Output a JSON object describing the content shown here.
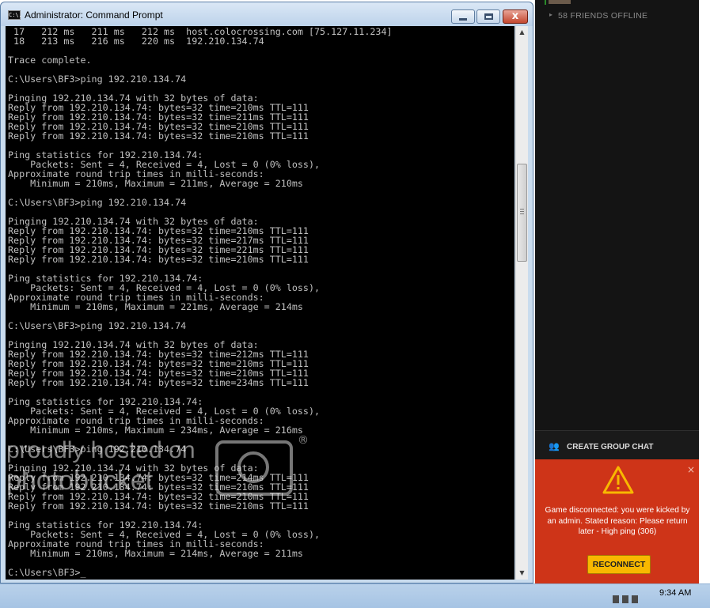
{
  "window": {
    "title": "Administrator: Command Prompt",
    "icon_text": "C:\\.",
    "close_glyph": "x"
  },
  "console": {
    "lines": [
      " 17   212 ms   211 ms   212 ms  host.colocrossing.com [75.127.11.234]",
      " 18   213 ms   216 ms   220 ms  192.210.134.74",
      "",
      "Trace complete.",
      "",
      "C:\\Users\\BF3>ping 192.210.134.74",
      "",
      "Pinging 192.210.134.74 with 32 bytes of data:",
      "Reply from 192.210.134.74: bytes=32 time=210ms TTL=111",
      "Reply from 192.210.134.74: bytes=32 time=211ms TTL=111",
      "Reply from 192.210.134.74: bytes=32 time=210ms TTL=111",
      "Reply from 192.210.134.74: bytes=32 time=210ms TTL=111",
      "",
      "Ping statistics for 192.210.134.74:",
      "    Packets: Sent = 4, Received = 4, Lost = 0 (0% loss),",
      "Approximate round trip times in milli-seconds:",
      "    Minimum = 210ms, Maximum = 211ms, Average = 210ms",
      "",
      "C:\\Users\\BF3>ping 192.210.134.74",
      "",
      "Pinging 192.210.134.74 with 32 bytes of data:",
      "Reply from 192.210.134.74: bytes=32 time=210ms TTL=111",
      "Reply from 192.210.134.74: bytes=32 time=217ms TTL=111",
      "Reply from 192.210.134.74: bytes=32 time=221ms TTL=111",
      "Reply from 192.210.134.74: bytes=32 time=210ms TTL=111",
      "",
      "Ping statistics for 192.210.134.74:",
      "    Packets: Sent = 4, Received = 4, Lost = 0 (0% loss),",
      "Approximate round trip times in milli-seconds:",
      "    Minimum = 210ms, Maximum = 221ms, Average = 214ms",
      "",
      "C:\\Users\\BF3>ping 192.210.134.74",
      "",
      "Pinging 192.210.134.74 with 32 bytes of data:",
      "Reply from 192.210.134.74: bytes=32 time=212ms TTL=111",
      "Reply from 192.210.134.74: bytes=32 time=210ms TTL=111",
      "Reply from 192.210.134.74: bytes=32 time=210ms TTL=111",
      "Reply from 192.210.134.74: bytes=32 time=234ms TTL=111",
      "",
      "Ping statistics for 192.210.134.74:",
      "    Packets: Sent = 4, Received = 4, Lost = 0 (0% loss),",
      "Approximate round trip times in milli-seconds:",
      "    Minimum = 210ms, Maximum = 234ms, Average = 216ms",
      "",
      "C:\\Users\\BF3>ping 192.210.134.74",
      "",
      "Pinging 192.210.134.74 with 32 bytes of data:",
      "Reply from 192.210.134.74: bytes=32 time=214ms TTL=111",
      "Reply from 192.210.134.74: bytes=32 time=210ms TTL=111",
      "Reply from 192.210.134.74: bytes=32 time=210ms TTL=111",
      "Reply from 192.210.134.74: bytes=32 time=210ms TTL=111",
      "",
      "Ping statistics for 192.210.134.74:",
      "    Packets: Sent = 4, Received = 4, Lost = 0 (0% loss),",
      "Approximate round trip times in milli-seconds:",
      "    Minimum = 210ms, Maximum = 214ms, Average = 211ms",
      "",
      "C:\\Users\\BF3>_"
    ]
  },
  "watermark": {
    "line1": "proudly hosted on",
    "line2": "photobucket",
    "reg_mark": "®"
  },
  "side_panel": {
    "friends_offline": "58 FRIENDS OFFLINE",
    "caret": "▸",
    "group_icon": "👥",
    "create_group_chat": "CREATE GROUP CHAT",
    "alert": {
      "close": "×",
      "message": "Game disconnected: you were kicked by an admin. Stated reason: Please return later - High ping (306)",
      "reconnect_label": "RECONNECT",
      "color": "#ce3418",
      "button_color": "#f8b800"
    }
  },
  "taskbar": {
    "clock": "9:34 AM"
  }
}
